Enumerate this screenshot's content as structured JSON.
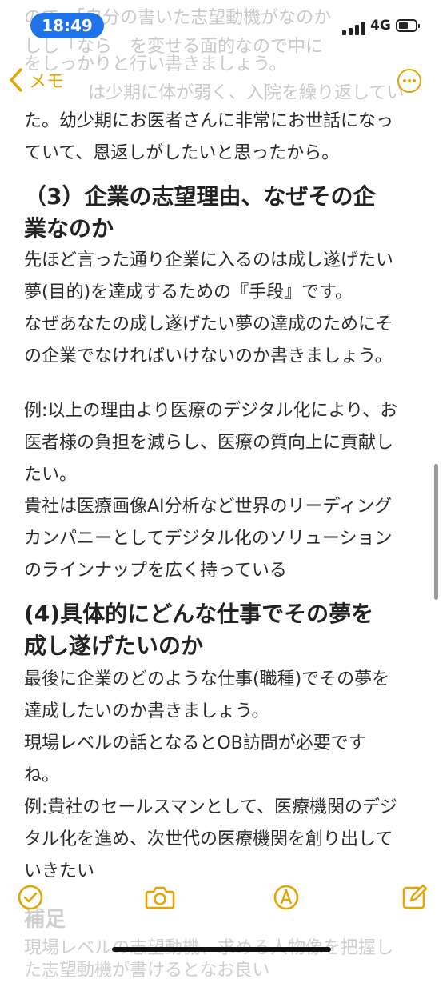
{
  "status_bar": {
    "time": "18:49",
    "network": "4G"
  },
  "nav": {
    "back_label": "メモ"
  },
  "background_text": [
    "ので、「自分の書いた志望動機がなのか",
    "しし「なら　を変せる面的なので中に",
    "をしっかりと行い書きましょう。",
    "は少期に体が弱く、入院を繰り返してい"
  ],
  "note": {
    "lines": [
      {
        "kind": "text",
        "text": "た。幼少期にお医者さんに非常にお世話になっ"
      },
      {
        "kind": "text",
        "text": "ていて、恩返しがしたいと思ったから。"
      },
      {
        "kind": "heading",
        "text": "（3）企業の志望理由、なぜその企"
      },
      {
        "kind": "heading",
        "text": "業なのか"
      },
      {
        "kind": "text",
        "text": "先ほど言った通り企業に入るのは成し遂げたい"
      },
      {
        "kind": "text",
        "text": "夢(目的)を達成するための『手段』です。"
      },
      {
        "kind": "text",
        "text": "なぜあなたの成し遂げたい夢の達成のためにそ"
      },
      {
        "kind": "text",
        "text": "の企業でなければいけないのか書きましょう。"
      },
      {
        "kind": "text",
        "text": "例:以上の理由より医療のデジタル化により、お"
      },
      {
        "kind": "text",
        "text": "医者様の負担を減らし、医療の質向上に貢献し"
      },
      {
        "kind": "text",
        "text": "たい。"
      },
      {
        "kind": "text",
        "text": "貴社は医療画像AI分析など世界のリーディング"
      },
      {
        "kind": "text",
        "text": "カンパニーとしてデジタル化のソリューション"
      },
      {
        "kind": "text",
        "text": "のラインナップを広く持っている"
      },
      {
        "kind": "heading",
        "text": "(4)具体的にどんな仕事でその夢を"
      },
      {
        "kind": "heading",
        "text": "成し遂げたいのか"
      },
      {
        "kind": "text",
        "text": "最後に企業のどのような仕事(職種)でその夢を"
      },
      {
        "kind": "text",
        "text": "達成したいのか書きましょう。"
      },
      {
        "kind": "text",
        "text": "現場レベルの話となるとOB訪問が必要です"
      },
      {
        "kind": "text",
        "text": "ね。"
      },
      {
        "kind": "text",
        "text": "例:貴社のセールスマンとして、医療機関のデジ"
      },
      {
        "kind": "text",
        "text": "タル化を進め、次世代の医療機関を創り出して"
      },
      {
        "kind": "text",
        "text": "いきたい"
      }
    ],
    "faded_heading": "補足",
    "faded_lines": [
      "現場レベルの志望動機、求める人物像を把握し",
      "た志望動機が書けるとなお良い"
    ]
  },
  "toolbar": {
    "icons": [
      "checklist-icon",
      "camera-icon",
      "markup-icon",
      "compose-icon"
    ]
  },
  "colors": {
    "accent": "#e4a500",
    "time_pill": "#1f73e8",
    "text": "#2b2b2b"
  }
}
